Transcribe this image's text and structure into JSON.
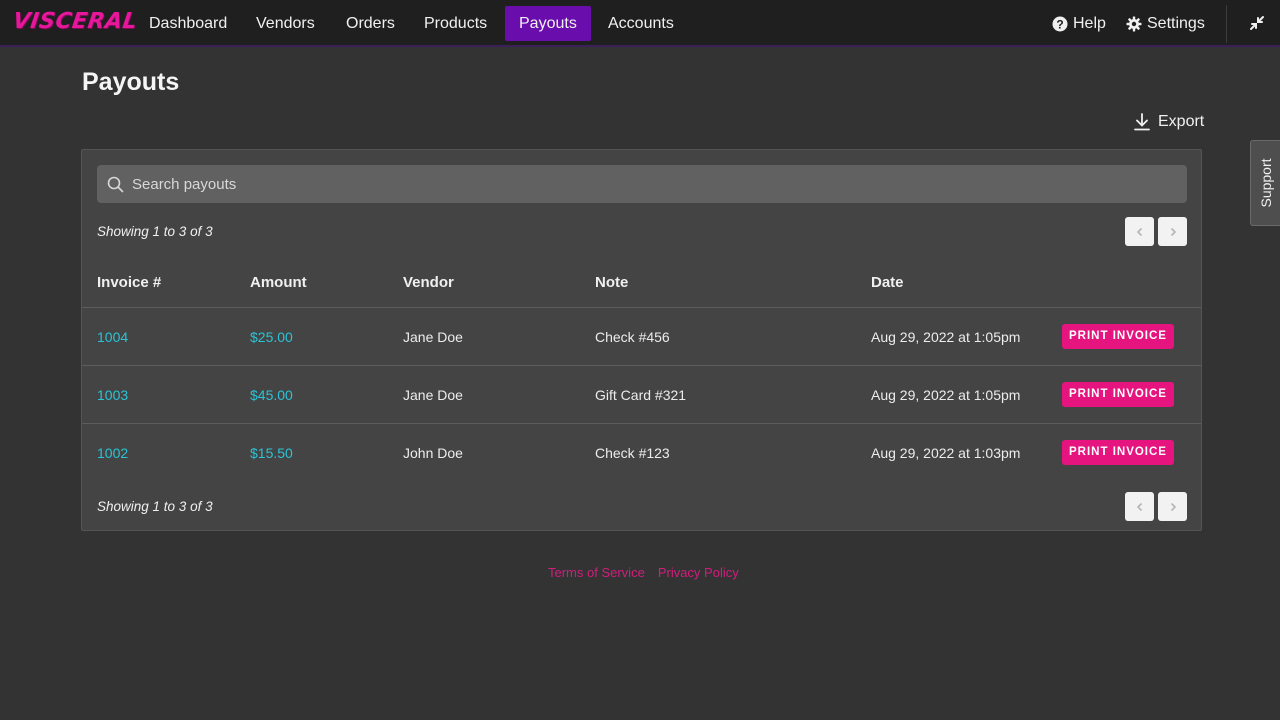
{
  "brand": {
    "logo_text": "VISCERAL",
    "accent": "#e6179b",
    "nav_active_bg": "#6a0dad",
    "link_color": "#2bc3d6"
  },
  "nav": {
    "items": [
      {
        "label": "Dashboard"
      },
      {
        "label": "Vendors"
      },
      {
        "label": "Orders"
      },
      {
        "label": "Products"
      },
      {
        "label": "Payouts",
        "active": true
      },
      {
        "label": "Accounts"
      }
    ],
    "help_label": "Help",
    "settings_label": "Settings"
  },
  "page": {
    "title": "Payouts",
    "export_label": "Export"
  },
  "search": {
    "placeholder": "Search payouts"
  },
  "table": {
    "showing_top": "Showing 1 to 3 of 3",
    "showing_bottom": "Showing 1 to 3 of 3",
    "columns": [
      "Invoice #",
      "Amount",
      "Vendor",
      "Note",
      "Date"
    ],
    "rows": [
      {
        "invoice": "1004",
        "amount": "$25.00",
        "vendor": "Jane Doe",
        "note": "Check #456",
        "date": "Aug 29, 2022 at 1:05pm",
        "action": "PRINT INVOICE"
      },
      {
        "invoice": "1003",
        "amount": "$45.00",
        "vendor": "Jane Doe",
        "note": "Gift Card #321",
        "date": "Aug 29, 2022 at 1:05pm",
        "action": "PRINT INVOICE"
      },
      {
        "invoice": "1002",
        "amount": "$15.50",
        "vendor": "John Doe",
        "note": "Check #123",
        "date": "Aug 29, 2022 at 1:03pm",
        "action": "PRINT INVOICE"
      }
    ]
  },
  "footer": {
    "terms": "Terms of Service",
    "privacy": "Privacy Policy"
  },
  "support": {
    "label": "Support"
  },
  "icons": [
    "help-circle-icon",
    "gear-icon",
    "collapse-icon",
    "download-icon",
    "search-icon",
    "chevron-left-icon",
    "chevron-right-icon"
  ]
}
